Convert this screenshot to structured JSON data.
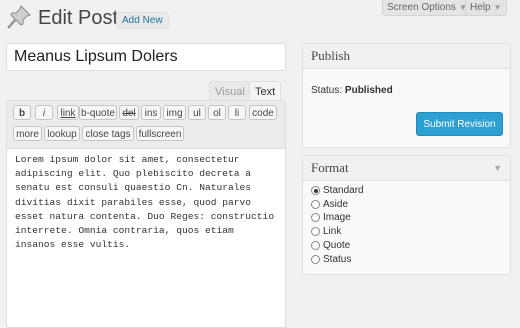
{
  "header": {
    "title": "Edit Post",
    "add_new_label": "Add New",
    "screen_options_label": "Screen Options",
    "help_label": "Help",
    "dropdown_arrow": "▼"
  },
  "post": {
    "title_value": "Meanus Lipsum Dolers",
    "content": "Lorem ipsum dolor sit amet, consectetur adipiscing elit. Quo plebiscito decreta a senatu est consuli quaestio Cn. Naturales divitias dixit parabiles esse, quod parvo esset natura contenta. Duo Reges: constructio interrete. Omnia contraria, quos etiam insanos esse vultis."
  },
  "editor": {
    "tabs": [
      {
        "label": "Visual"
      },
      {
        "label": "Text"
      }
    ],
    "toolbar": [
      {
        "label": "b"
      },
      {
        "label": "i"
      },
      {
        "label": "link"
      },
      {
        "label": "b-quote"
      },
      {
        "label": "del"
      },
      {
        "label": "ins"
      },
      {
        "label": "img"
      },
      {
        "label": "ul"
      },
      {
        "label": "ol"
      },
      {
        "label": "li"
      },
      {
        "label": "code"
      },
      {
        "label": "more"
      },
      {
        "label": "lookup"
      },
      {
        "label": "close tags"
      },
      {
        "label": "fullscreen"
      }
    ]
  },
  "publish": {
    "title": "Publish",
    "status_label": "Status:",
    "status_value": "Published",
    "submit_label": "Submit Revision"
  },
  "format": {
    "title": "Format",
    "toggle_icon": "▼",
    "options": [
      {
        "label": "Standard",
        "checked": true
      },
      {
        "label": "Aside",
        "checked": false
      },
      {
        "label": "Image",
        "checked": false
      },
      {
        "label": "Link",
        "checked": false
      },
      {
        "label": "Quote",
        "checked": false
      },
      {
        "label": "Status",
        "checked": false
      }
    ]
  },
  "colors": {
    "primary_button": "#2e9fd2",
    "link": "#21759b",
    "background": "#f1f1f1"
  },
  "icons": {
    "page_icon": "pushpin-icon"
  }
}
